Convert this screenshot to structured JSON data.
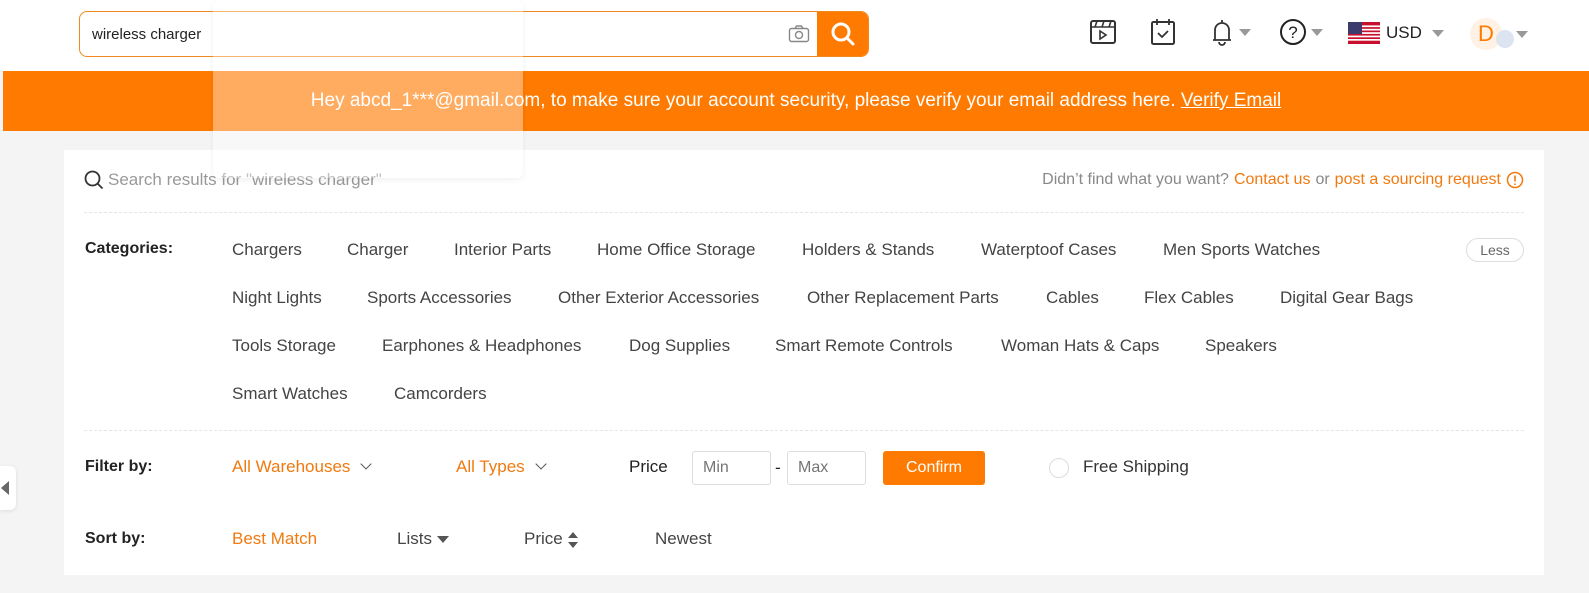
{
  "header": {
    "search_value": "wireless charger",
    "currency": "USD",
    "avatar_letter": "D",
    "icons": [
      "video-icon",
      "calendar-check-icon",
      "bell-icon",
      "help-icon",
      "us-flag-icon"
    ]
  },
  "banner": {
    "text": "Hey abcd_1***@gmail.com, to make sure your account security, please verify your email address here.",
    "link": "Verify Email"
  },
  "results": {
    "text": "Search results for \"wireless charger\"",
    "not_found": "Didn’t find what you want?",
    "contact": "Contact us",
    "or": "or",
    "sourcing": "post a sourcing request"
  },
  "categories": {
    "label": "Categories:",
    "less": "Less",
    "items": [
      "Chargers",
      "Charger",
      "Interior Parts",
      "Home Office Storage",
      "Holders & Stands",
      "Waterptoof Cases",
      "Men Sports Watches",
      "Night Lights",
      "Sports Accessories",
      "Other Exterior Accessories",
      "Other Replacement Parts",
      "Cables",
      "Flex Cables",
      "Digital Gear Bags",
      "Tools Storage",
      "Earphones & Headphones",
      "Dog Supplies",
      "Smart Remote Controls",
      "Woman Hats & Caps",
      "Speakers",
      "Smart Watches",
      "Camcorders"
    ]
  },
  "filter": {
    "label": "Filter by:",
    "warehouses": "All Warehouses",
    "types": "All Types",
    "price": "Price",
    "min": "Min",
    "max": "Max",
    "dash": "-",
    "confirm": "Confirm",
    "free_shipping": "Free Shipping"
  },
  "sort": {
    "label": "Sort by:",
    "best": "Best Match",
    "lists": "Lists",
    "price": "Price",
    "newest": "Newest"
  },
  "colors": {
    "accent": "#ff7a00"
  }
}
